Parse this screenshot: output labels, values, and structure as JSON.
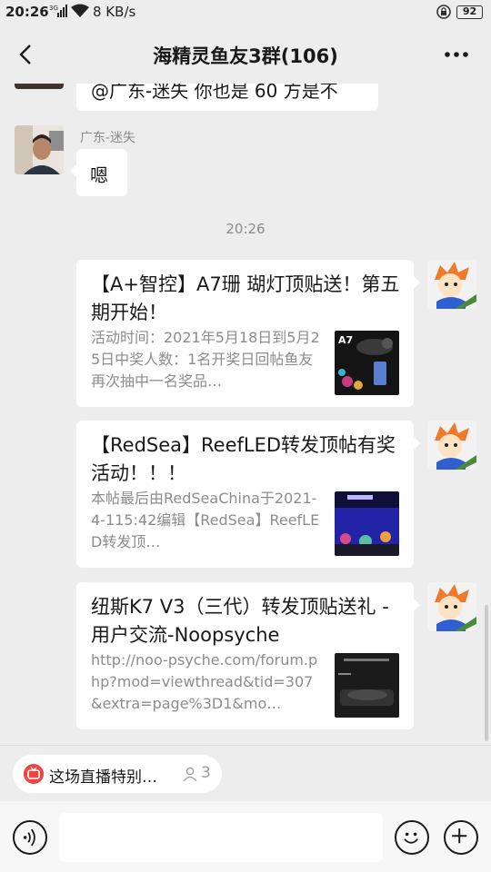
{
  "status_bar": {
    "time": "20:26",
    "network_speed": "8 KB/s",
    "battery": "92",
    "signal_label": "3G",
    "icons": [
      "signal-icon",
      "wifi-icon",
      "alarm-icon",
      "battery-icon"
    ]
  },
  "header": {
    "title": "海精灵鱼友3群(106)",
    "icons": [
      "back-chevron-icon",
      "more-icon"
    ]
  },
  "messages": {
    "partial_bubble_text": "@广东-迷失  你也是 60 方是不",
    "sender_name": "广东-迷失",
    "reply_text": "嗯",
    "timestamp": "20:26",
    "cards": [
      {
        "title": "【A+智控】A7珊 瑚灯顶贴送！第五期开始！",
        "description": "活动时间：2021年5月18日到5月25日中奖人数：1名开奖日回帖鱼友再次抽中一名奖品…",
        "thumb_label": "A7"
      },
      {
        "title": "【RedSea】ReefLED转发顶帖有奖活动！！！",
        "description": "本帖最后由RedSeaChina于2021-4-115:42编辑【RedSea】ReefLED转发顶…"
      },
      {
        "title": "纽斯K7 V3（三代）转发顶贴送礼 - 用户交流-Noopsyche",
        "description": "http://noo-psyche.com/forum.php?mod=viewthread&tid=307&extra=page%3D1&mo…"
      }
    ]
  },
  "live": {
    "text": "这场直播特别…",
    "count": "3",
    "icons": [
      "live-icon",
      "people-icon"
    ]
  },
  "input_bar": {
    "placeholder": "",
    "icons": [
      "voice-icon",
      "emoji-icon",
      "plus-icon"
    ]
  },
  "colors": {
    "background": "#ededed",
    "bubble": "#ffffff",
    "live_red": "#f04343",
    "gray_text": "#8c8c8c"
  }
}
